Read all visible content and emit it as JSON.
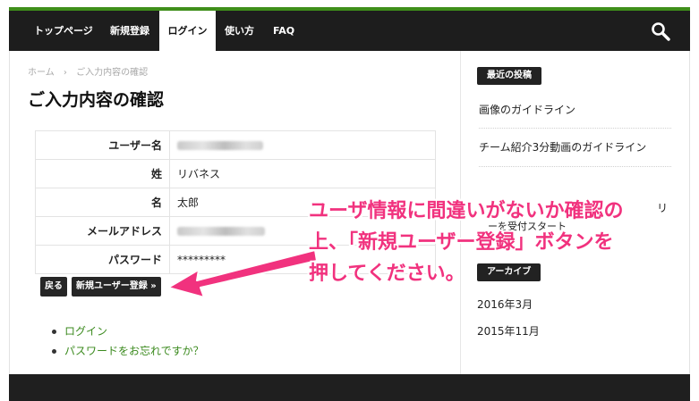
{
  "nav": {
    "items": [
      {
        "label": "トップページ"
      },
      {
        "label": "新規登録"
      },
      {
        "label": "ログイン"
      },
      {
        "label": "使い方"
      },
      {
        "label": "FAQ"
      }
    ],
    "active_index": 2,
    "search_icon": "search-icon"
  },
  "breadcrumb": {
    "home": "ホーム",
    "separator": "›",
    "current": "ご入力内容の確認"
  },
  "page_title": "ご入力内容の確認",
  "confirm_table": {
    "rows": [
      {
        "label": "ユーザー名",
        "value": "",
        "redacted": true
      },
      {
        "label": "姓",
        "value": "リバネス",
        "redacted": false
      },
      {
        "label": "名",
        "value": "太郎",
        "redacted": false
      },
      {
        "label": "メールアドレス",
        "value": "",
        "redacted": true
      },
      {
        "label": "パスワード",
        "value": "*********",
        "redacted": false
      }
    ]
  },
  "buttons": {
    "back": "戻る",
    "register": "新規ユーザー登録 »"
  },
  "links": [
    {
      "label": "ログイン"
    },
    {
      "label": "パスワードをお忘れですか？"
    }
  ],
  "sidebar": {
    "recent_title": "最近の投稿",
    "recent_posts": [
      "画像のガイドライン",
      "チーム紹介3分動画のガイドライン",
      "リ",
      "ーを受付スタート"
    ],
    "archive_title": "アーカイブ",
    "archives": [
      "2016年3月",
      "2015年11月"
    ]
  },
  "annotation": {
    "line1": "ユーザ情報に間違いがないか確認の",
    "line2": "上、「新規ユーザー登録」ボタンを",
    "line3": "押してください。",
    "color": "#f1327e"
  },
  "colors": {
    "accent_green": "#3f8f1a",
    "nav_bg": "#1d1d1d",
    "link_green": "#3b8a1e"
  }
}
